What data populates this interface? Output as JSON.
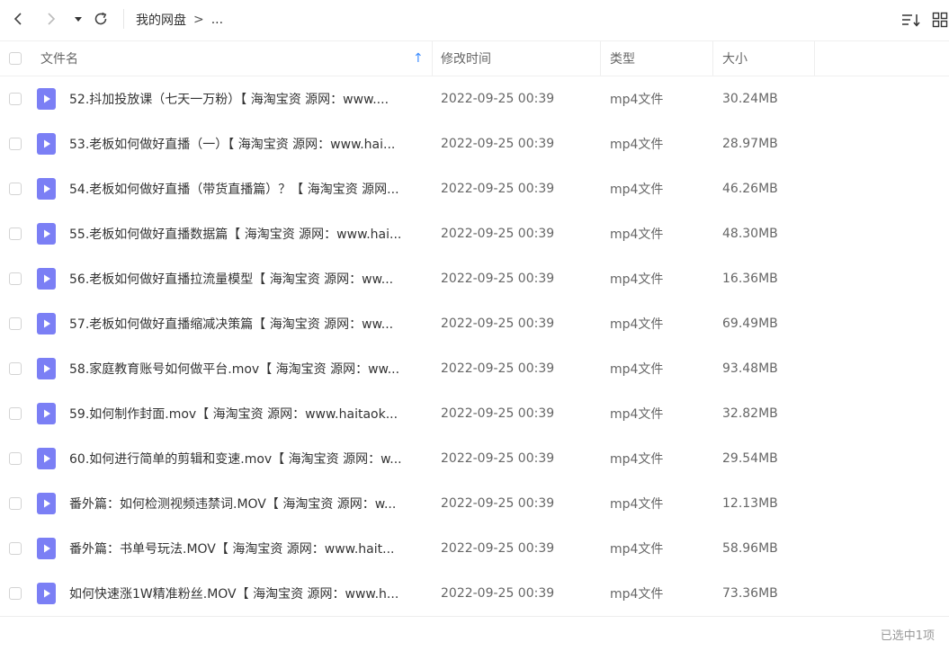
{
  "breadcrumb": {
    "root": "我的网盘",
    "separator": ">",
    "current": "..."
  },
  "toolbar": {
    "back_icon": "chevron-left-icon",
    "forward_icon": "chevron-right-icon",
    "dropdown_icon": "caret-down-icon",
    "refresh_icon": "refresh-icon",
    "sort_icon": "sort-list-icon",
    "grid_icon": "grid-view-icon"
  },
  "table": {
    "headers": {
      "name": "文件名",
      "time": "修改时间",
      "type": "类型",
      "size": "大小"
    },
    "sort_indicator": "↑",
    "rows": [
      {
        "name": "52.抖加投放课（七天一万粉）【 海淘宝资 源网：www....",
        "time": "2022-09-25 00:39",
        "type": "mp4文件",
        "size": "30.24MB"
      },
      {
        "name": "53.老板如何做好直播（一）【 海淘宝资 源网：www.hai...",
        "time": "2022-09-25 00:39",
        "type": "mp4文件",
        "size": "28.97MB"
      },
      {
        "name": "54.老板如何做好直播（带货直播篇）？【 海淘宝资 源网...",
        "time": "2022-09-25 00:39",
        "type": "mp4文件",
        "size": "46.26MB"
      },
      {
        "name": "55.老板如何做好直播数据篇【 海淘宝资 源网：www.hai...",
        "time": "2022-09-25 00:39",
        "type": "mp4文件",
        "size": "48.30MB"
      },
      {
        "name": "56.老板如何做好直播拉流量模型【 海淘宝资 源网：ww...",
        "time": "2022-09-25 00:39",
        "type": "mp4文件",
        "size": "16.36MB"
      },
      {
        "name": "57.老板如何做好直播缩减决策篇【 海淘宝资 源网：ww...",
        "time": "2022-09-25 00:39",
        "type": "mp4文件",
        "size": "69.49MB"
      },
      {
        "name": "58.家庭教育账号如何做平台.mov【 海淘宝资 源网：ww...",
        "time": "2022-09-25 00:39",
        "type": "mp4文件",
        "size": "93.48MB"
      },
      {
        "name": "59.如何制作封面.mov【 海淘宝资 源网：www.haitaok...",
        "time": "2022-09-25 00:39",
        "type": "mp4文件",
        "size": "32.82MB"
      },
      {
        "name": "60.如何进行简单的剪辑和变速.mov【 海淘宝资 源网：w...",
        "time": "2022-09-25 00:39",
        "type": "mp4文件",
        "size": "29.54MB"
      },
      {
        "name": "番外篇：如何检测视频违禁词.MOV【 海淘宝资 源网：w...",
        "time": "2022-09-25 00:39",
        "type": "mp4文件",
        "size": "12.13MB"
      },
      {
        "name": "番外篇：书单号玩法.MOV【 海淘宝资 源网：www.hait...",
        "time": "2022-09-25 00:39",
        "type": "mp4文件",
        "size": "58.96MB"
      },
      {
        "name": "如何快速涨1W精准粉丝.MOV【 海淘宝资 源网：www.h...",
        "time": "2022-09-25 00:39",
        "type": "mp4文件",
        "size": "73.36MB"
      }
    ]
  },
  "status": {
    "selection_text": "已选中1项"
  },
  "colors": {
    "file_icon": "#7b7ff5",
    "sort_arrow": "#3b8cff"
  }
}
